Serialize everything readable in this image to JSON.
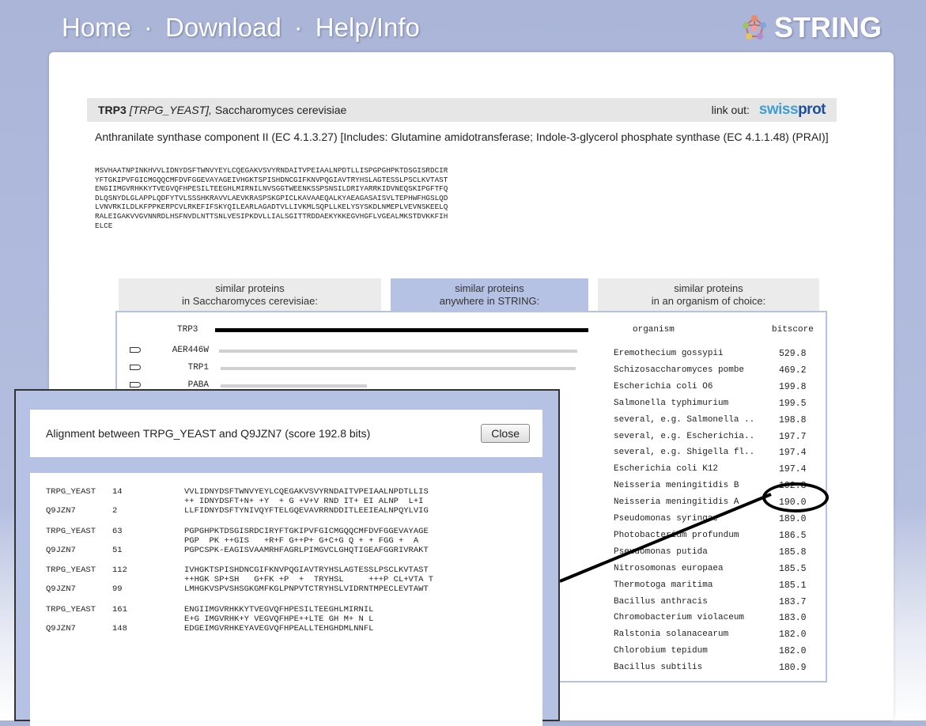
{
  "nav": {
    "home": "Home",
    "download": "Download",
    "help": "Help/Info",
    "sep": "·"
  },
  "brand": {
    "name": "STRING"
  },
  "protein": {
    "name": "TRP3",
    "id": "[TRPG_YEAST],",
    "organism": "Saccharomyces cerevisiae",
    "link_out": "link out:",
    "swiss_a": "swiss",
    "swiss_b": "prot",
    "description": "Anthranilate synthase component II (EC 4.1.3.27) [Includes: Glutamine amidotransferase; Indole-3-glycerol phosphate synthase (EC 4.1.1.48) (PRAI)]",
    "sequence": "MSVHAATNPINKHVVLIDNYDSFTWNVYEYLCQEGAKVSVYRNDAITVPEIAALNPDTLLISPGPGHPKTDSGISRDCIR\nYFTGKIPVFGICMGQQCMFDVFGGEVAYAGEIVHGKTSPISHDNCGIFKNVPQGIAVTRYHSLAGTESSLPSCLKVTAST\nENGIIMGVRHKKYTVEGVQFHPESILTEEGHLMIRNILNVSGGTWEENKSSPSNSILDRIYARRKIDVNEQSKIPGFTFQ\nDLQSNYDLGLAPPLQDFYTVLSSSHKRAVVLAEVKRASPSKGPICLKAVAAEQALKYAEAGASAISVLTEPHWFHGSLQD\nLVNVRKILDLKFPPKERPCVLRKEFIFSKYQILEARLAGADTVLLIVKMLSQPLLKELYSYSKDLNMEPLVEVNSKEELQ\nRALEIGAKVVGVNNRDLHSFNVDLNTTSNLVESIPKDVLLIALSGITTRDDAEKYKKEGVHGFLVGEALMKSTDVKKFIH\nELCE"
  },
  "tabs": [
    {
      "line1": "similar proteins",
      "line2": "in Saccharomyces cerevisiae:"
    },
    {
      "line1": "similar proteins",
      "line2": "anywhere in STRING:"
    },
    {
      "line1": "similar proteins",
      "line2": "in an organism of choice:"
    }
  ],
  "list": {
    "query": "TRP3",
    "col_organism": "organism",
    "col_bitscore": "bitscore",
    "hits": [
      {
        "name": "AER446W",
        "start": 0.02,
        "len": 0.98
      },
      {
        "name": "TRP1",
        "start": 0.03,
        "len": 0.97
      },
      {
        "name": "PABA",
        "start": 0.03,
        "len": 0.4
      }
    ],
    "organisms": [
      {
        "organism": "Eremothecium gossypii",
        "score": "529.8"
      },
      {
        "organism": "Schizosaccharomyces pombe",
        "score": "469.2"
      },
      {
        "organism": "Escherichia coli O6",
        "score": "199.8"
      },
      {
        "organism": "Salmonella typhimurium",
        "score": "199.5"
      },
      {
        "organism": "several, e.g. Salmonella ..",
        "score": "198.8"
      },
      {
        "organism": "several, e.g. Escherichia..",
        "score": "197.7"
      },
      {
        "organism": "several, e.g. Shigella fl..",
        "score": "197.4"
      },
      {
        "organism": "Escherichia coli K12",
        "score": "197.4"
      },
      {
        "organism": "Neisseria meningitidis B",
        "score": "192.8"
      },
      {
        "organism": "Neisseria meningitidis A",
        "score": "190.0"
      },
      {
        "organism": "Pseudomonas syringae",
        "score": "189.0"
      },
      {
        "organism": "Photobacterium profundum",
        "score": "186.5"
      },
      {
        "organism": "Pseudomonas putida",
        "score": "185.8"
      },
      {
        "organism": "Nitrosomonas europaea",
        "score": "185.5"
      },
      {
        "organism": "Thermotoga maritima",
        "score": "185.1"
      },
      {
        "organism": "Bacillus anthracis",
        "score": "183.7"
      },
      {
        "organism": "Chromobacterium violaceum",
        "score": "183.0"
      },
      {
        "organism": "Ralstonia solanacearum",
        "score": "182.0"
      },
      {
        "organism": "Chlorobium tepidum",
        "score": "182.0"
      },
      {
        "organism": "Bacillus subtilis",
        "score": "180.9"
      }
    ]
  },
  "popup": {
    "title": "Alignment between TRPG_YEAST and Q9JZN7 (score 192.8 bits)",
    "close": "Close",
    "blocks": [
      {
        "q_name": "TRPG_YEAST",
        "q_pos": "14",
        "q_seq": "VVLIDNYDSFTWNVYEYLCQEGAKVSVYRNDAITVPEIAALNPDTLLIS",
        "mid": "++ IDNYDSFT+N+ +Y  + G +V+V RND IT+ EI ALNP  L+I",
        "s_name": "Q9JZN7",
        "s_pos": "2",
        "s_seq": "LLFIDNYDSFTYNIVQYFTELGQEVAVRRNDDITLEEIEALNPQYLVIG"
      },
      {
        "q_name": "TRPG_YEAST",
        "q_pos": "63",
        "q_seq": "PGPGHPKTDSGISRDCIRYFTGKIPVFGICMGQQCMFDVFGGEVAYAGE",
        "mid": "PGP  PK ++GIS   +R+F G++P+ G+C+G Q + + FGG +  A",
        "s_name": "Q9JZN7",
        "s_pos": "51",
        "s_seq": "PGPCSPK-EAGISVAAMRHFAGRLPIMGVCLGHQTIGEAFGGRIVRAKT"
      },
      {
        "q_name": "TRPG_YEAST",
        "q_pos": "112",
        "q_seq": "IVHGKTSPISHDNCGIFKNVPQGIAVTRYHSLAGTESSLPSCLKVTAST",
        "mid": "++HGK SP+SH   G+FK +P  +  TRYHSL     +++P CL+VTA T",
        "s_name": "Q9JZN7",
        "s_pos": "99",
        "s_seq": "LMHGKVSPVSHSGKGMFKGLPNPVTCTRYHSLVIDRNTMPECLEVTAWT"
      },
      {
        "q_name": "TRPG_YEAST",
        "q_pos": "161",
        "q_seq": "ENGIIMGVRHKKYTVEGVQFHPESILTEEGHLMIRNIL",
        "mid": "E+G IMGVRHK+Y VEGVQFHPE++LTE GH M+ N L",
        "s_name": "Q9JZN7",
        "s_pos": "148",
        "s_seq": "EDGEIMGVRHKEYAVEGVQFHPEALLTEHGHDMLNNFL"
      }
    ]
  }
}
